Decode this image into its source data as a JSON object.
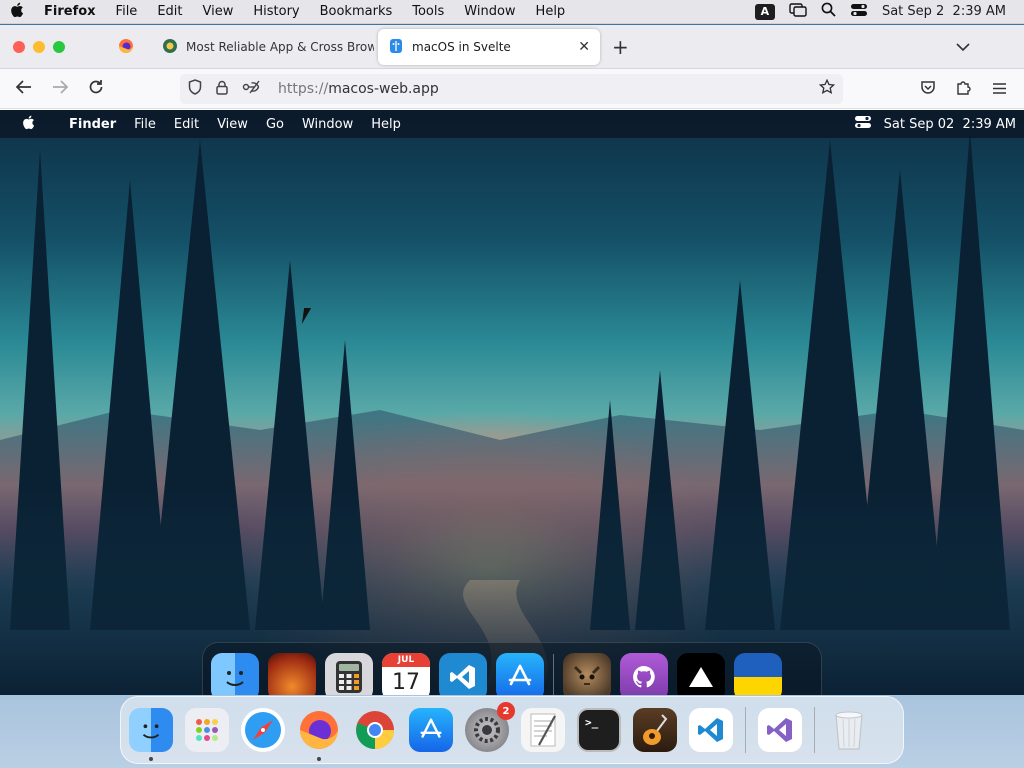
{
  "system_menubar": {
    "apple_icon": "apple-logo-icon",
    "app_name": "Firefox",
    "menus": [
      "File",
      "Edit",
      "View",
      "History",
      "Bookmarks",
      "Tools",
      "Window",
      "Help"
    ],
    "input_source": "A",
    "datetime": "Sat Sep 2  2:39 AM"
  },
  "browser": {
    "tabs": [
      {
        "title": "",
        "icon": "firefox-icon",
        "pinned": true
      },
      {
        "title": "Most Reliable App & Cross Brow",
        "icon": "lambdatest-icon"
      },
      {
        "title": "macOS in Svelte",
        "icon": "svelte-app-icon",
        "active": true
      }
    ],
    "url_scheme": "https://",
    "url_host": "macos-web.app"
  },
  "inner_desktop": {
    "menubar": {
      "apple_icon": "apple-logo-icon",
      "app_name": "Finder",
      "menus": [
        "File",
        "Edit",
        "View",
        "Go",
        "Window",
        "Help"
      ],
      "datetime": "Sat Sep 02  2:39 AM"
    },
    "calendar": {
      "month": "JUL",
      "day": "17"
    },
    "dock": [
      {
        "name": "Finder",
        "icon": "finder-icon",
        "running": true,
        "color": "#2e8cf0"
      },
      {
        "name": "Wallpapers",
        "icon": "wallpapers-icon",
        "running": false,
        "color": "#d2541a"
      },
      {
        "name": "Calculator",
        "icon": "calculator-icon",
        "running": false,
        "color": "#c9c9c9"
      },
      {
        "name": "Calendar",
        "icon": "calendar-icon",
        "running": false,
        "color": "#ffffff"
      },
      {
        "name": "VS Code",
        "icon": "vscode-icon",
        "running": false,
        "color": "#1f8ad2"
      },
      {
        "name": "App Store",
        "icon": "app-store-icon",
        "running": false,
        "color": "#1a7ef5"
      },
      {
        "name": "Purus Twitter",
        "icon": "cat-avatar-icon",
        "running": false,
        "color": "#6b5a44"
      },
      {
        "name": "GitHub",
        "icon": "github-icon",
        "running": true,
        "color": "#9b4fc4"
      },
      {
        "name": "Vercel",
        "icon": "vercel-icon",
        "running": true,
        "color": "#000000"
      },
      {
        "name": "Ukraine",
        "icon": "ukraine-flag-icon",
        "running": true,
        "color": "#1f5fbd"
      }
    ]
  },
  "outer_dock": [
    {
      "name": "Finder",
      "icon": "finder-icon",
      "running": true,
      "color": "#2e8cf0"
    },
    {
      "name": "Launchpad",
      "icon": "launchpad-icon",
      "running": false,
      "color": "#e9e9ef"
    },
    {
      "name": "Safari",
      "icon": "safari-icon",
      "running": false,
      "color": "#2f9df2"
    },
    {
      "name": "Firefox",
      "icon": "firefox-icon",
      "running": true,
      "color": "#e2582f"
    },
    {
      "name": "Chrome",
      "icon": "chrome-icon",
      "running": false,
      "color": "#ffffff"
    },
    {
      "name": "App Store",
      "icon": "app-store-icon",
      "running": false,
      "color": "#1a7ef5"
    },
    {
      "name": "System Settings",
      "icon": "system-settings-icon",
      "running": false,
      "color": "#8a8a8f",
      "badge": "2"
    },
    {
      "name": "TextEdit",
      "icon": "textedit-icon",
      "running": false,
      "color": "#f5f5f5"
    },
    {
      "name": "Terminal",
      "icon": "terminal-icon",
      "running": false,
      "color": "#1e1e1e"
    },
    {
      "name": "GarageBand",
      "icon": "garageband-icon",
      "running": false,
      "color": "#3a2a1e"
    },
    {
      "name": "VS Code",
      "icon": "vscode-icon",
      "running": false,
      "color": "#ffffff"
    },
    {
      "name": "Visual Studio",
      "icon": "visual-studio-icon",
      "running": false,
      "color": "#ffffff"
    },
    {
      "name": "Trash",
      "icon": "trash-icon",
      "running": false,
      "color": "#e6e9ee"
    }
  ],
  "colors": {
    "close": "#ff5f57",
    "minimize": "#febc2e",
    "zoom": "#28c840",
    "badge": "#e5392d"
  }
}
